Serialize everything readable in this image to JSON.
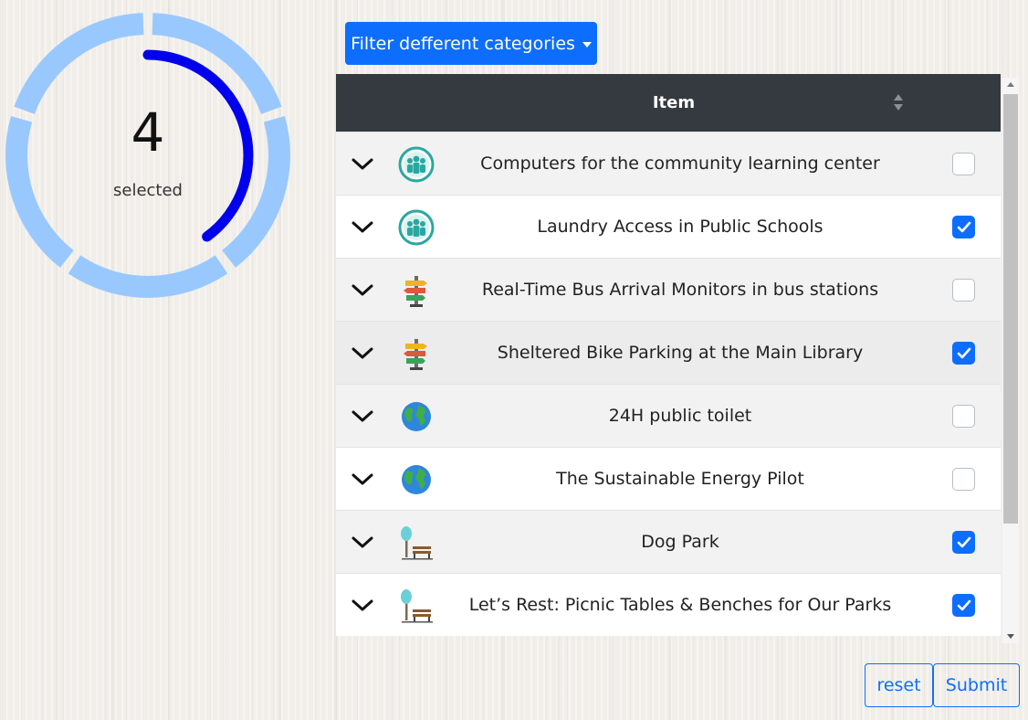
{
  "gauge": {
    "count": "4",
    "label": "selected",
    "segments": 5,
    "outer_color": "#99c8ff",
    "progress_color": "#0000ee",
    "progress_fraction": 0.4
  },
  "filter": {
    "label": "Filter defferent categories",
    "icon": "caret-down-icon"
  },
  "table": {
    "header": {
      "item": "Item",
      "sort_icon": "sort-icon"
    },
    "rows": [
      {
        "title": "Computers for the community learning center",
        "icon": "community-icon",
        "checked": false
      },
      {
        "title": "Laundry Access in Public Schools",
        "icon": "community-icon",
        "checked": true
      },
      {
        "title": "Real-Time Bus Arrival Monitors in bus stations",
        "icon": "signpost-icon",
        "checked": false
      },
      {
        "title": "Sheltered Bike Parking at the Main Library",
        "icon": "signpost-icon",
        "checked": true
      },
      {
        "title": "24H public toilet",
        "icon": "globe-icon",
        "checked": false
      },
      {
        "title": "The Sustainable Energy Pilot",
        "icon": "globe-icon",
        "checked": false
      },
      {
        "title": "Dog Park",
        "icon": "park-bench-icon",
        "checked": true
      },
      {
        "title": "Let’s Rest: Picnic Tables & Benches for Our Parks",
        "icon": "park-bench-icon",
        "checked": true
      }
    ]
  },
  "actions": {
    "reset_label": "reset",
    "submit_label": "Submit"
  },
  "colors": {
    "primary": "#0d6efd",
    "header_bg": "#343a40"
  }
}
